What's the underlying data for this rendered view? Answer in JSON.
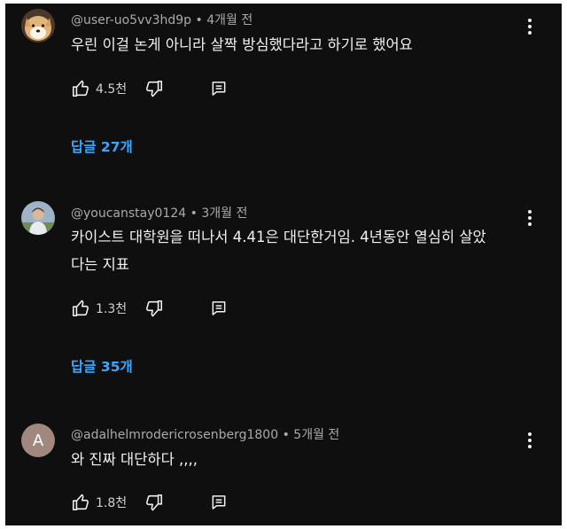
{
  "comments": [
    {
      "handle": "@user-uo5vv3hd9p",
      "time": "4개월 전",
      "text": "우린 이걸 논게 아니라 살짝 방심했다라고 하기로 했어요",
      "likes": "4.5천",
      "replies": "답글 27개",
      "avatar": "dog-avatar"
    },
    {
      "handle": "@youcanstay0124",
      "time": "3개월 전",
      "text": "카이스트 대학원을 떠나서 4.41은 대단한거임. 4년동안 열심히 살았다는 지표",
      "likes": "1.3천",
      "replies": "답글 35개",
      "avatar": "person-avatar"
    },
    {
      "handle": "@adalhelmrodericrosenberg1800",
      "time": "5개월 전",
      "text": "와 진짜 대단하다 ,,,,",
      "likes": "1.8천",
      "avatar": "letter-avatar",
      "avatar_letter": "A",
      "avatar_color": "#a1887f"
    }
  ],
  "colors": {
    "background": "#0f0f0f",
    "text": "#f1f1f1",
    "meta": "#aaaaaa",
    "replies_link": "#3ea6ff"
  }
}
